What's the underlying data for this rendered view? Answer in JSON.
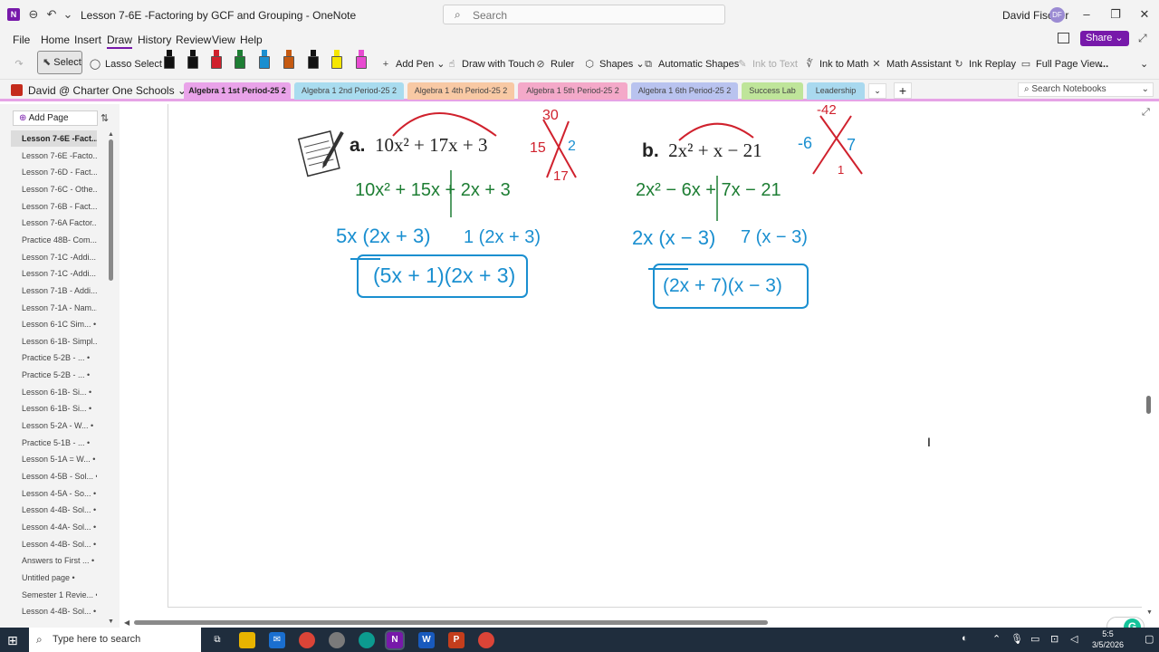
{
  "window": {
    "title": "Lesson 7-6E -Factoring by GCF and Grouping  -  OneNote",
    "search_placeholder": "Search",
    "user_name": "David Fischer",
    "user_initials": "DF",
    "app_letter": "N"
  },
  "menu": {
    "items": [
      "File",
      "Home",
      "Insert",
      "Draw",
      "History",
      "Review",
      "View",
      "Help"
    ],
    "active": "Draw",
    "share_label": "Share"
  },
  "ribbon": {
    "select": "Select",
    "lasso_select": "Lasso Select",
    "add_pen": "Add Pen",
    "draw_with_touch": "Draw with Touch",
    "ruler": "Ruler",
    "shapes": "Shapes",
    "automatic_shapes": "Automatic Shapes",
    "ink_to_text": "Ink to Text",
    "ink_to_math": "Ink to Math",
    "math_assistant": "Math Assistant",
    "ink_replay": "Ink Replay",
    "full_page_view": "Full Page View",
    "more": "...",
    "pen_colors": [
      "#111111",
      "#111111",
      "#d0212d",
      "#1e7e34",
      "#1a8fd0",
      "#c55a11",
      "#111111",
      "#f5e600",
      "#e84bd1"
    ]
  },
  "notebook": {
    "name": "David @ Charter One Schools",
    "search_placeholder": "Search Notebooks",
    "sections": [
      {
        "label": "Algebra 1 1st Period-25 2",
        "color": "#e9a3e9",
        "active": true
      },
      {
        "label": "Algebra 1 2nd Period-25 2",
        "color": "#a9dcef",
        "active": false
      },
      {
        "label": "Algebra 1 4th Period-25 2",
        "color": "#f8c9a4",
        "active": false
      },
      {
        "label": "Algebra 1 5th Period-25 2",
        "color": "#f4a9c9",
        "active": false
      },
      {
        "label": "Algebra 1 6th Period-25 2",
        "color": "#b9c3ef",
        "active": false
      },
      {
        "label": "Success Lab",
        "color": "#bfe59a",
        "active": false
      },
      {
        "label": "Leadership",
        "color": "#a9d9ef",
        "active": false
      }
    ]
  },
  "pages": {
    "add_page_label": "Add Page",
    "items": [
      {
        "label": "Lesson 7-6E -Fact...",
        "active": true
      },
      {
        "label": "Lesson 7-6E -Facto...",
        "active": false
      },
      {
        "label": "Lesson 7-6D - Fact...",
        "active": false
      },
      {
        "label": "Lesson 7-6C - Othe...",
        "active": false
      },
      {
        "label": "Lesson 7-6B - Fact...",
        "active": false
      },
      {
        "label": "Lesson 7-6A Factor...",
        "active": false
      },
      {
        "label": "Practice 48B- Com...",
        "active": false
      },
      {
        "label": "Lesson 7-1C -Addi...",
        "active": false
      },
      {
        "label": "Lesson 7-1C -Addi...",
        "active": false
      },
      {
        "label": "Lesson 7-1B - Addi...",
        "active": false
      },
      {
        "label": "Lesson 7-1A - Nam...",
        "active": false
      },
      {
        "label": "Lesson 6-1C Sim... •",
        "active": false
      },
      {
        "label": "Lesson 6-1B- Simpl...",
        "active": false
      },
      {
        "label": "Practice 5-2B - ... •",
        "active": false
      },
      {
        "label": "Practice 5-2B - ... •",
        "active": false
      },
      {
        "label": "Lesson 6-1B- Si... •",
        "active": false
      },
      {
        "label": "Lesson 6-1B- Si... •",
        "active": false
      },
      {
        "label": "Lesson 5-2A - W... •",
        "active": false
      },
      {
        "label": "Practice 5-1B - ... •",
        "active": false
      },
      {
        "label": "Lesson 5-1A = W... •",
        "active": false
      },
      {
        "label": "Lesson 4-5B - Sol... •",
        "active": false
      },
      {
        "label": "Lesson 4-5A - So... •",
        "active": false
      },
      {
        "label": "Lesson 4-4B- Sol... •",
        "active": false
      },
      {
        "label": "Lesson 4-4A- Sol... •",
        "active": false
      },
      {
        "label": "Lesson 4-4B- Sol... •",
        "active": false
      },
      {
        "label": "Answers to First ... •",
        "active": false
      },
      {
        "label": "Untitled page •",
        "active": false
      },
      {
        "label": "Semester 1 Revie... •",
        "active": false
      },
      {
        "label": "Lesson 4-4B- Sol... •",
        "active": false
      }
    ]
  },
  "content": {
    "problem_a": {
      "label": "a.",
      "expression": "10x² + 17x + 3"
    },
    "problem_b": {
      "label": "b.",
      "expression": "2x² + x − 21"
    },
    "ink": {
      "a_product": "30",
      "a_left": "15",
      "a_right": "2",
      "a_sum": "17",
      "a_split": "10x² + 15x + 2x + 3",
      "a_gcf_left": "5x (2x + 3)",
      "a_gcf_right": "1 (2x + 3)",
      "a_answer": "(5x + 1)(2x + 3)",
      "b_product": "-42",
      "b_left": "-6",
      "b_right": "7",
      "b_sum": "1",
      "b_split": "2x² − 6x + 7x − 21",
      "b_gcf_left": "2x (x − 3)",
      "b_gcf_right": "7 (x − 3)",
      "b_answer": "(2x + 7)(x − 3)"
    },
    "colors": {
      "red": "#d0212d",
      "green": "#1e7e34",
      "blue": "#1a8fd0"
    }
  },
  "taskbar": {
    "search_placeholder": "Type here to search",
    "time": "5:5",
    "date": "3/5/2026"
  }
}
